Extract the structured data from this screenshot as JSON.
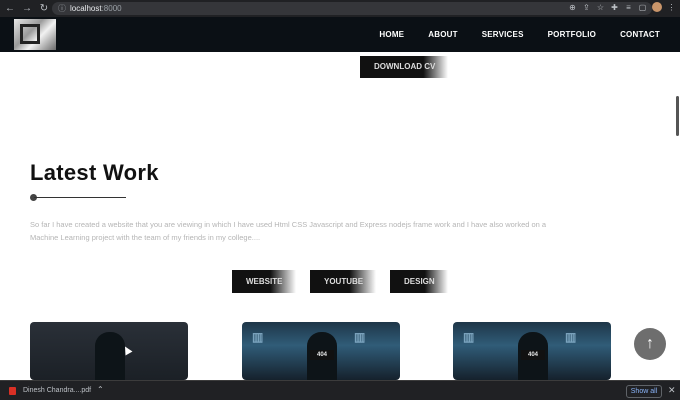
{
  "browser": {
    "back_icon": "back-arrow-icon",
    "forward_icon": "forward-arrow-icon",
    "reload_icon": "reload-icon",
    "url_host": "localhost",
    "url_port": ":8000"
  },
  "header": {
    "nav": [
      "HOME",
      "ABOUT",
      "SERVICES",
      "PORTFOLIO",
      "CONTACT"
    ]
  },
  "hero": {
    "download_label": "DOWNLOAD CV"
  },
  "work": {
    "title": "Latest Work",
    "description": "So far I have created a website that you are viewing in which I have used Html CSS Javascript and Express nodejs frame work and I have also worked on a Machine Learning project with the team of my friends in my college....",
    "filters": [
      "WEBSITE",
      "YOUTUBE",
      "DESIGN"
    ],
    "card_badge": "404"
  },
  "download_shelf": {
    "file_name": "Dinesh Chandra....pdf",
    "show_all": "Show all"
  },
  "colors": {
    "header_bg": "#0b1015",
    "browser_bg": "#202124",
    "button_dark": "#111111",
    "link_blue": "#8ab4f8"
  }
}
